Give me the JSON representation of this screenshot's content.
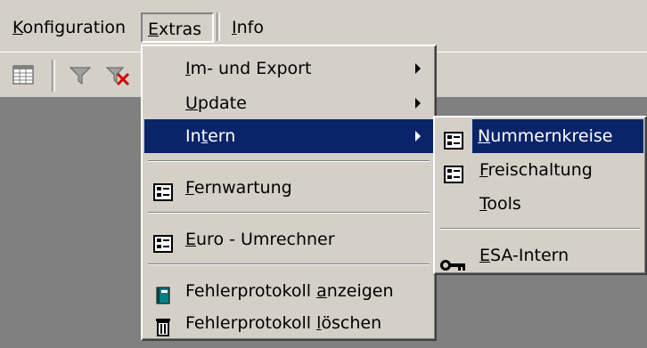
{
  "menubar": {
    "items": [
      {
        "pre": "",
        "accel": "K",
        "post": "onfiguration"
      },
      {
        "pre": "",
        "accel": "E",
        "post": "xtras"
      },
      {
        "pre": "",
        "accel": "I",
        "post": "nfo"
      }
    ]
  },
  "toolbar": {
    "buttons": [
      "table-icon",
      "filter-icon",
      "filter-remove-icon"
    ]
  },
  "extras_menu": {
    "items": [
      {
        "pre": "",
        "accel": "I",
        "post": "m- und Export",
        "submenu": true
      },
      {
        "pre": "",
        "accel": "U",
        "post": "pdate",
        "submenu": true
      },
      {
        "pre": "In",
        "accel": "t",
        "post": "ern",
        "submenu": true,
        "highlighted": true
      },
      {
        "pre": "",
        "accel": "F",
        "post": "ernwartung",
        "icon": "form-icon"
      },
      {
        "pre": "",
        "accel": "E",
        "post": "uro - Umrechner",
        "icon": "form-icon"
      },
      {
        "pre": "Fehlerprotokoll ",
        "accel": "a",
        "post": "nzeigen",
        "icon": "book-icon"
      },
      {
        "pre": "Fehlerprotokoll ",
        "accel": "l",
        "post": "öschen",
        "icon": "trash-icon"
      }
    ]
  },
  "intern_menu": {
    "items": [
      {
        "pre": "",
        "accel": "N",
        "post": "ummernkreise",
        "icon": "form-icon",
        "highlighted": true
      },
      {
        "pre": "",
        "accel": "F",
        "post": "reischaltung",
        "icon": "form-icon"
      },
      {
        "pre": "",
        "accel": "T",
        "post": "ools"
      },
      {
        "pre": "",
        "accel": "E",
        "post": "SA-Intern",
        "icon": "key-icon"
      }
    ]
  },
  "colors": {
    "highlight": "#0a246a",
    "face": "#d4d0c8",
    "desktop": "#808080"
  }
}
